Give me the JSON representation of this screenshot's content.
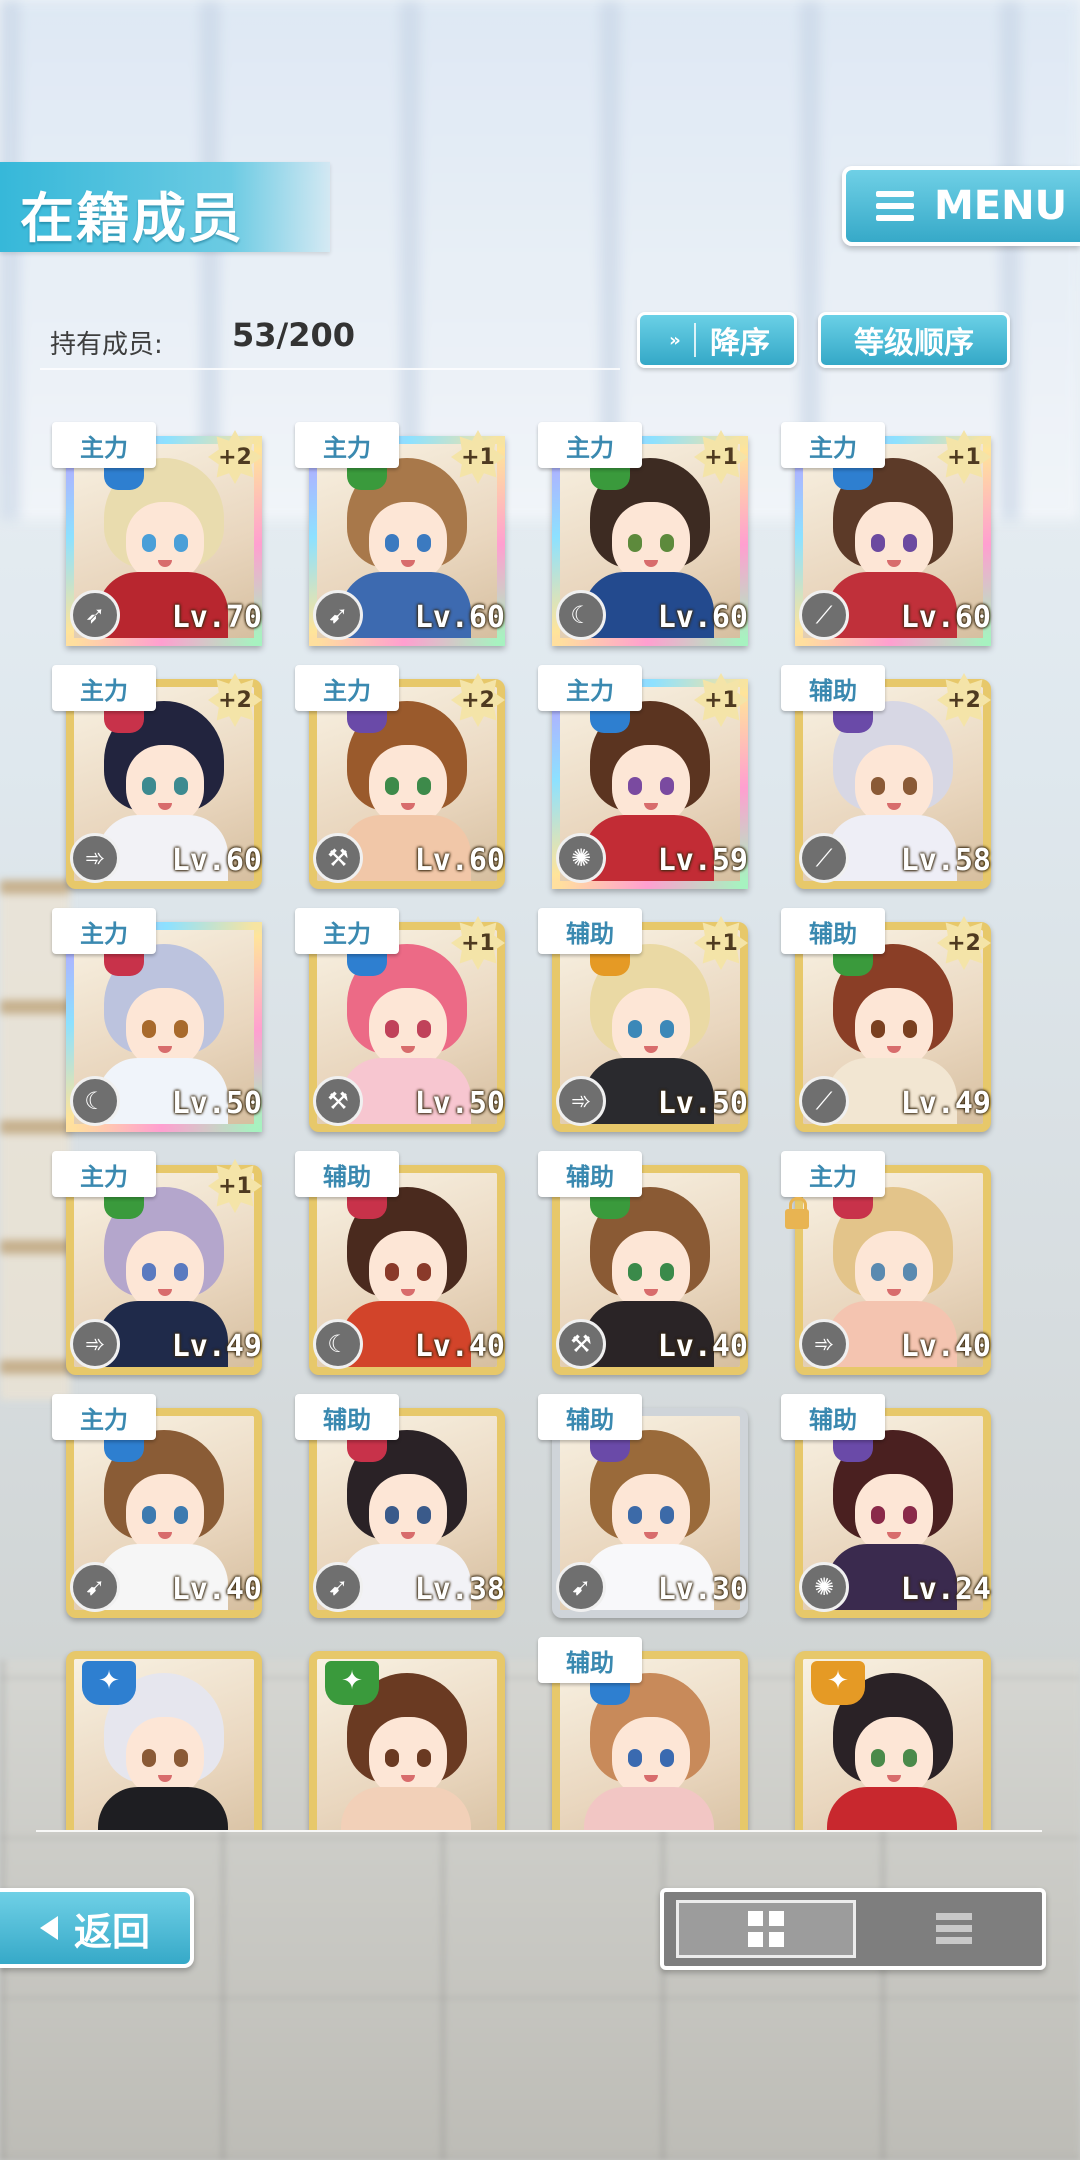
{
  "header": {
    "title": "在籍成员",
    "menu_label": "MENU"
  },
  "counter": {
    "label": "持有成员:",
    "value": "53/200"
  },
  "sort": {
    "order_label": "降序",
    "order_icon": "double-chevron-down-icon",
    "key_label": "等级顺序"
  },
  "colors": {
    "accent": "#36a9c8",
    "tag_text": "#3a89b0",
    "attr_blue": "#2e7fd0",
    "attr_green": "#3a9a3c",
    "attr_red": "#c8324a",
    "attr_purple": "#6a4aa8",
    "attr_orange": "#e59a25"
  },
  "cards": [
    {
      "role": "主力",
      "plus": "+2",
      "level": "Lv.70",
      "attr": "blue",
      "frame": "rainbow",
      "weapon_icon": "missile-launcher-icon",
      "hair": "#e9dcae",
      "eye": "#4a9fd8",
      "outfit": "#b8262f"
    },
    {
      "role": "主力",
      "plus": "+1",
      "level": "Lv.60",
      "attr": "green",
      "frame": "rainbow",
      "weapon_icon": "rocket-icon",
      "hair": "#a8784a",
      "eye": "#3b7ac0",
      "outfit": "#3d6ab0"
    },
    {
      "role": "主力",
      "plus": "+1",
      "level": "Lv.60",
      "attr": "green",
      "frame": "rainbow",
      "weapon_icon": "scythe-icon",
      "hair": "#3d2b22",
      "eye": "#5d8a3c",
      "outfit": "#234a8e"
    },
    {
      "role": "主力",
      "plus": "+1",
      "level": "Lv.60",
      "attr": "blue",
      "frame": "rainbow",
      "weapon_icon": "staff-icon",
      "hair": "#5c3a28",
      "eye": "#6c4aa0",
      "outfit": "#c0303a"
    },
    {
      "role": "主力",
      "plus": "+2",
      "level": "Lv.60",
      "attr": "red",
      "frame": "gold",
      "weapon_icon": "cannon-icon",
      "hair": "#22243e",
      "eye": "#3d8a90",
      "outfit": "#f2f2f6"
    },
    {
      "role": "主力",
      "plus": "+2",
      "level": "Lv.60",
      "attr": "purple",
      "frame": "gold",
      "weapon_icon": "hammer-icon",
      "hair": "#9a5a2c",
      "eye": "#3d8a4a",
      "outfit": "#f1c7a8"
    },
    {
      "role": "主力",
      "plus": "+1",
      "level": "Lv.59",
      "attr": "blue",
      "frame": "rainbow",
      "weapon_icon": "shield-icon",
      "hair": "#5b3420",
      "eye": "#7a4aa0",
      "outfit": "#c22c35"
    },
    {
      "role": "辅助",
      "plus": "+2",
      "level": "Lv.58",
      "attr": "purple",
      "frame": "gold",
      "weapon_icon": "staff-icon",
      "hair": "#d7d7e4",
      "eye": "#8a5a36",
      "outfit": "#eeeef6"
    },
    {
      "role": "主力",
      "plus": "",
      "level": "Lv.50",
      "attr": "red",
      "frame": "rainbow",
      "weapon_icon": "scythe-icon",
      "hair": "#bcc3de",
      "eye": "#a86a2c",
      "outfit": "#f0f4fa"
    },
    {
      "role": "主力",
      "plus": "+1",
      "level": "Lv.50",
      "attr": "blue",
      "frame": "gold",
      "weapon_icon": "hammer-icon",
      "hair": "#ec6a86",
      "eye": "#c0425a",
      "outfit": "#f7c6d0"
    },
    {
      "role": "辅助",
      "plus": "+1",
      "level": "Lv.50",
      "attr": "orange",
      "frame": "gold",
      "weapon_icon": "cannon-icon",
      "hair": "#ead9a4",
      "eye": "#3c88b8",
      "outfit": "#2a2a2e"
    },
    {
      "role": "辅助",
      "plus": "+2",
      "level": "Lv.49",
      "attr": "green",
      "frame": "gold",
      "weapon_icon": "staff-icon",
      "hair": "#8a3e26",
      "eye": "#7a4020",
      "outfit": "#f2e6d2"
    },
    {
      "role": "主力",
      "plus": "+1",
      "level": "Lv.49",
      "attr": "green",
      "frame": "gold",
      "weapon_icon": "cannon-icon",
      "hair": "#b4a6cc",
      "eye": "#5a7ac0",
      "outfit": "#1f2a4a"
    },
    {
      "role": "辅助",
      "plus": "",
      "level": "Lv.40",
      "attr": "red",
      "frame": "gold",
      "weapon_icon": "scythe-icon",
      "hair": "#4a2a1e",
      "eye": "#8a3a2a",
      "outfit": "#d2442a"
    },
    {
      "role": "辅助",
      "plus": "",
      "level": "Lv.40",
      "attr": "green",
      "frame": "gold",
      "weapon_icon": "hammer-icon",
      "hair": "#8a5a34",
      "eye": "#3a8a4a",
      "outfit": "#2a2426"
    },
    {
      "role": "主力",
      "plus": "",
      "level": "Lv.40",
      "attr": "red",
      "frame": "gold",
      "weapon_icon": "cannon-icon",
      "hair": "#e3c48a",
      "eye": "#5a8ab0",
      "outfit": "#f4c4b0",
      "locked": true
    },
    {
      "role": "主力",
      "plus": "",
      "level": "Lv.40",
      "attr": "blue",
      "frame": "gold",
      "weapon_icon": "rocket-icon",
      "hair": "#8a5c36",
      "eye": "#3c7ab0",
      "outfit": "#f6f6f6"
    },
    {
      "role": "辅助",
      "plus": "",
      "level": "Lv.38",
      "attr": "red",
      "frame": "gold",
      "weapon_icon": "rocket-icon",
      "hair": "#2a2226",
      "eye": "#3a5a8a",
      "outfit": "#f2f2f6"
    },
    {
      "role": "辅助",
      "plus": "",
      "level": "Lv.30",
      "attr": "purple",
      "frame": "silver",
      "weapon_icon": "rocket-icon",
      "hair": "#9a6a3a",
      "eye": "#3c6aa8",
      "outfit": "#f8f8fa"
    },
    {
      "role": "辅助",
      "plus": "",
      "level": "Lv.24",
      "attr": "purple",
      "frame": "gold",
      "weapon_icon": "shield-icon",
      "hair": "#4a2020",
      "eye": "#8a2a4a",
      "outfit": "#3a2a4e"
    },
    {
      "role": "",
      "plus": "",
      "level": "",
      "attr": "blue",
      "attr_top": true,
      "frame": "gold",
      "weapon_icon": "",
      "hair": "#e6e6ee",
      "eye": "#8a5a36",
      "outfit": "#1e1e22"
    },
    {
      "role": "",
      "plus": "",
      "level": "",
      "attr": "green",
      "attr_top": true,
      "frame": "gold",
      "weapon_icon": "",
      "hair": "#6a3a22",
      "eye": "#6a3a22",
      "outfit": "#f2d0b8"
    },
    {
      "role": "辅助",
      "plus": "",
      "level": "",
      "attr": "blue",
      "frame": "gold",
      "weapon_icon": "",
      "hair": "#c88a5a",
      "eye": "#3a6ab0",
      "outfit": "#f2c6c4"
    },
    {
      "role": "",
      "plus": "",
      "level": "",
      "attr": "orange",
      "attr_top": true,
      "frame": "gold",
      "weapon_icon": "",
      "hair": "#2a2226",
      "eye": "#4a8a4a",
      "outfit": "#c8282e"
    }
  ],
  "footer": {
    "back_label": "返回",
    "grid_view_icon": "grid-view-icon",
    "list_view_icon": "list-view-icon"
  }
}
